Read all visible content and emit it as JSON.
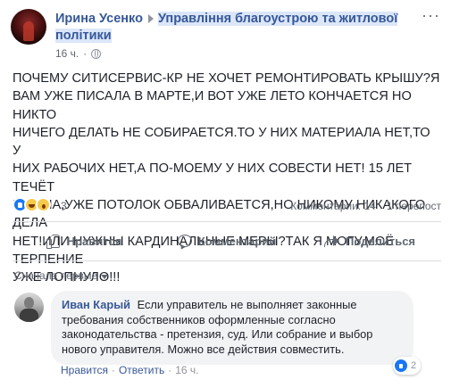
{
  "post": {
    "author": "Ирина Усенко",
    "group": "Управління благоустрою та житлової політики",
    "time": "16 ч.",
    "more_label": "···",
    "text": "ПОЧЕМУ СИТИСЕРВИС-КР НЕ ХОЧЕТ РЕМОНТИРОВАТЬ КРЫШУ?Я\nВАМ УЖЕ ПИСАЛА В МАРТЕ,И ВОТ УЖЕ ЛЕТО КОНЧАЕТСЯ НО НИКТО\nНИЧЕГО ДЕЛАТЬ НЕ СОБИРАЕТСЯ.ТО У НИХ МАТЕРИАЛА НЕТ,ТО У\nНИХ РАБОЧИХ НЕТ,А ПО-МОЕМУ У НИХ СОВЕСТИ НЕТ! 15 ЛЕТ ТЕЧЁТ\nКРЫША,УЖЕ ПОТОЛОК ОБВАЛИВАЕТСЯ,НО НИКОМУ НИКАКОГО ДЕЛА\nНЕТ!ИЛИ НУЖНЫ КАРДИНАЛЬНЫЕ МЕРЫ?ТАК Я МОГУ,МОЁ ТЕРПЕНИЕ\nУЖЕ ЛОПНУЛО!!!"
  },
  "stats": {
    "reactions_count": "3",
    "comments": "Комментарии: 14",
    "shares": "1 перепост"
  },
  "actions": {
    "like": "Нравится",
    "comment": "Комментарий",
    "share": "Поделиться"
  },
  "sort": {
    "label": "Сначала первые"
  },
  "comment": {
    "author": "Иван Карый",
    "text": "Если управитель не выполняет законные требования собственников оформленные согласно законодательства - претензия, суд. Или собрание и выбор нового управителя. Можно все действия совместить.",
    "reactions_count": "2",
    "like_label": "Нравится",
    "reply_label": "Ответить",
    "separator": "·",
    "time": "16 ч."
  },
  "colors": {
    "link": "#365899",
    "group_highlight": "#dbe6f9",
    "like_blue": "#1877f2"
  }
}
